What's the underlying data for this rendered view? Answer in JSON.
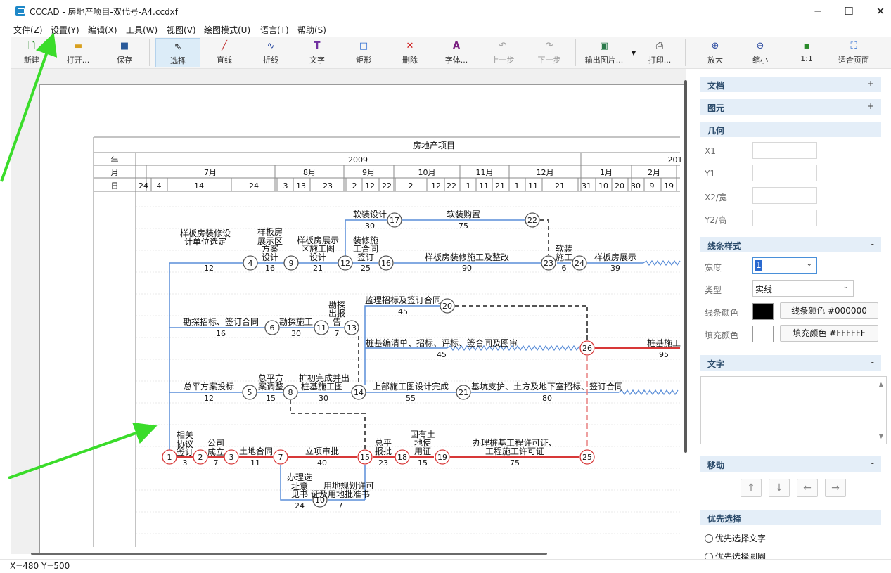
{
  "window": {
    "title": "CCCAD - 房地产项目-双代号-A4.ccdxf",
    "minimize": "─",
    "maximize": "☐",
    "close": "✕"
  },
  "menu": [
    "文件(Z)",
    "设置(Y)",
    "编辑(X)",
    "工具(W)",
    "视图(V)",
    "绘图模式(U)",
    "语言(T)",
    "帮助(S)"
  ],
  "toolbar": {
    "new": "新建",
    "open": "打开...",
    "save": "保存",
    "select": "选择",
    "line": "直线",
    "polyline": "折线",
    "text": "文字",
    "rect": "矩形",
    "delete": "删除",
    "font": "字体...",
    "undo": "上一步",
    "redo": "下一步",
    "export": "输出图片...",
    "print": "打印...",
    "zoom_in": "放大",
    "zoom_out": "缩小",
    "actual": "1:1",
    "fit": "适合页面"
  },
  "panel": {
    "sec_doc": "文档",
    "sec_elem": "图元",
    "sec_geo": "几何",
    "sec_line": "线条样式",
    "sec_text": "文字",
    "sec_move": "移动",
    "sec_prio": "优先选择",
    "plus": "+",
    "minus": "-",
    "x1": "X1",
    "y1": "Y1",
    "x2": "X2/宽",
    "y2": "Y2/高",
    "width_label": "宽度",
    "width_value": "1",
    "type_label": "类型",
    "type_value": "实线",
    "line_color_label": "线条颜色",
    "line_color_btn": "线条颜色 #000000",
    "line_color": "#000000",
    "fill_color_label": "填充颜色",
    "fill_color_btn": "填充颜色 #FFFFFF",
    "fill_color": "#FFFFFF",
    "move_up": "↑",
    "move_down": "↓",
    "move_left": "←",
    "move_right": "→",
    "prio_text": "优先选择文字",
    "prio_circle": "优先选择圆圈"
  },
  "status": "X=480 Y=500",
  "chart_data": {
    "type": "network-diagram",
    "title": "房地产项目",
    "header": {
      "year_label": "年",
      "month_label": "月",
      "day_label": "日",
      "years": [
        "2009",
        "201"
      ],
      "months": [
        "7月",
        "8月",
        "9月",
        "10月",
        "11月",
        "12月",
        "1月",
        "2月"
      ],
      "days": [
        "24",
        "4",
        "14",
        "24",
        "3",
        "13",
        "23",
        "2",
        "12",
        "22",
        "2",
        "12",
        "22",
        "1",
        "11",
        "21",
        "1",
        "11",
        "21",
        "31",
        "10",
        "20",
        "30",
        "9",
        "19"
      ]
    },
    "nodes": [
      "1",
      "2",
      "3",
      "4",
      "5",
      "6",
      "7",
      "8",
      "9",
      "10",
      "11",
      "12",
      "13",
      "14",
      "15",
      "16",
      "17",
      "18",
      "19",
      "20",
      "21",
      "22",
      "23",
      "24",
      "25",
      "26"
    ],
    "activities": [
      {
        "from": "1",
        "to": "2",
        "label": "相关协议签订",
        "days": "3"
      },
      {
        "from": "2",
        "to": "3",
        "label": "公司成立",
        "days": "7"
      },
      {
        "from": "3",
        "to": "7",
        "label": "土地合同",
        "days": "11"
      },
      {
        "from": "7",
        "to": "15",
        "label": "立项审批",
        "days": "40"
      },
      {
        "from": "7",
        "to": "10",
        "label": "办理选址意见书",
        "days": "24"
      },
      {
        "from": "10",
        "to": "15",
        "label": "用地规划许可证及用地批准书",
        "days": "7"
      },
      {
        "from": "15",
        "to": "18",
        "label": "总平报批",
        "days": "23"
      },
      {
        "from": "18",
        "to": "19",
        "label": "国有土地使用证",
        "days": "15"
      },
      {
        "from": "19",
        "to": "25",
        "label": "办理桩基工程许可证、工程施工许可证",
        "days": "75"
      },
      {
        "from": "1",
        "to": "5",
        "label": "总平方案投标",
        "days": "12"
      },
      {
        "from": "5",
        "to": "8",
        "label": "总平方案调整",
        "days": "15"
      },
      {
        "from": "8",
        "to": "14",
        "label": "扩初完成并出桩基施工图",
        "days": "30"
      },
      {
        "from": "14",
        "to": "21",
        "label": "上部施工图设计完成",
        "days": "55"
      },
      {
        "from": "21",
        "to": "26",
        "label": "基坑支护、土方及地下室招标、签订合同",
        "days": "80"
      },
      {
        "from": "1",
        "to": "6",
        "label": "勘探招标、签订合同",
        "days": "16"
      },
      {
        "from": "6",
        "to": "11",
        "label": "勘探施工",
        "days": "30"
      },
      {
        "from": "11",
        "to": "13",
        "label": "勘探出报告",
        "days": "7"
      },
      {
        "from": "14",
        "to": "20",
        "label": "监理招标及签订合同",
        "days": "45"
      },
      {
        "from": "14",
        "to": "26",
        "label": "桩基编清单、招标、评标、签合同及图审",
        "days": "45"
      },
      {
        "from": "26",
        "to": "",
        "label": "桩基施工",
        "days": "95"
      },
      {
        "from": "1",
        "to": "4",
        "label": "样板房装修设计单位选定",
        "days": "12"
      },
      {
        "from": "4",
        "to": "9",
        "label": "样板房展示区方案设计",
        "days": "16"
      },
      {
        "from": "9",
        "to": "12",
        "label": "样板房展示区施工图设计",
        "days": "21"
      },
      {
        "from": "12",
        "to": "16",
        "label": "装修施工合同签订",
        "days": "25"
      },
      {
        "from": "12",
        "to": "17",
        "label": "软装设计",
        "days": "30"
      },
      {
        "from": "17",
        "to": "22",
        "label": "软装购置",
        "days": "75"
      },
      {
        "from": "16",
        "to": "23",
        "label": "样板房装修施工及整改",
        "days": "90"
      },
      {
        "from": "23",
        "to": "24",
        "label": "软装施工",
        "days": "6"
      },
      {
        "from": "24",
        "to": "",
        "label": "样板房展示",
        "days": "39"
      }
    ]
  }
}
